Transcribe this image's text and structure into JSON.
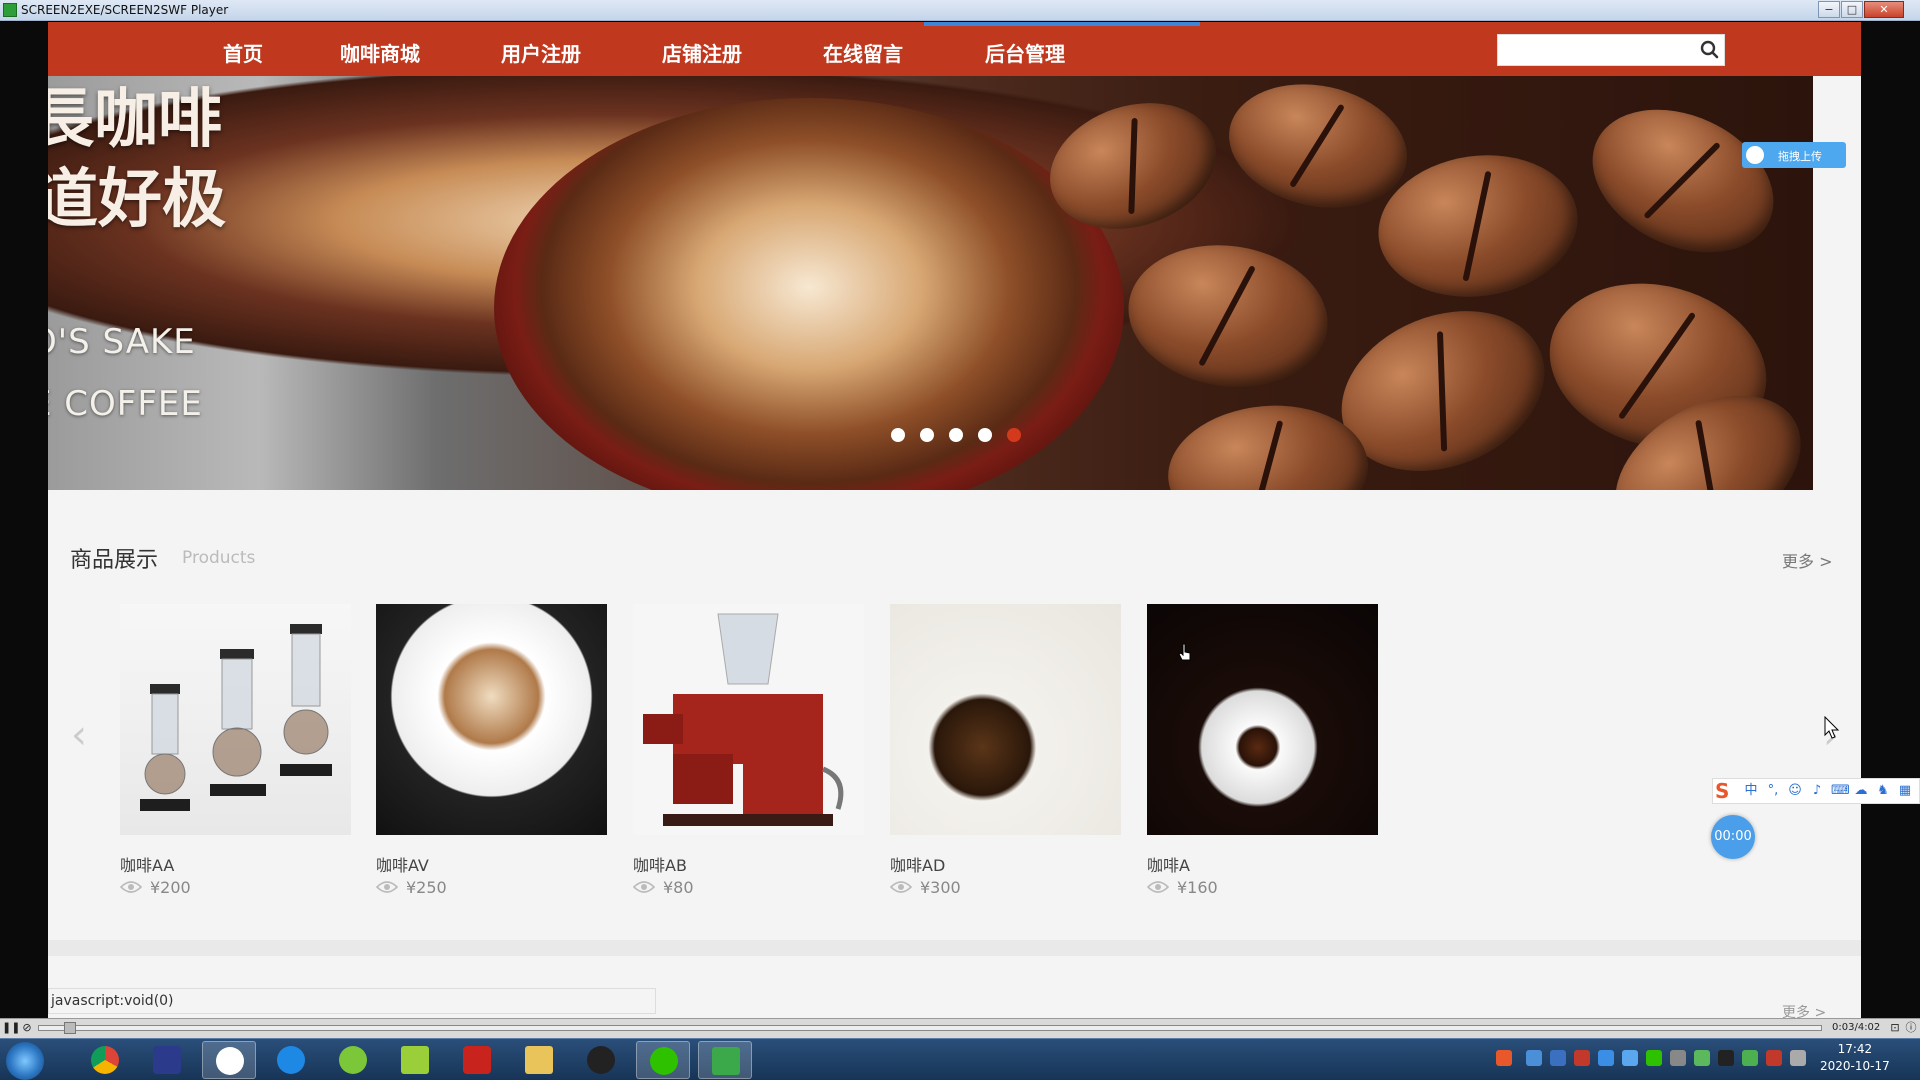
{
  "window": {
    "title": "SCREEN2EXE/SCREEN2SWF Player",
    "buttons": [
      "−",
      "□",
      "✕"
    ]
  },
  "nav": {
    "items": [
      "首页",
      "咖啡商城",
      "用户注册",
      "店铺注册",
      "在线留言",
      "后台管理"
    ],
    "search_placeholder": "",
    "search_icon": "search-icon"
  },
  "banner": {
    "lines": [
      "長咖啡",
      "道好极",
      "O'S SAKE",
      "E COFFEE"
    ],
    "dots": 5,
    "active_dot": 5
  },
  "upload_badge": {
    "label": "拖拽上传",
    "icon": "baidu-cloud-icon"
  },
  "products": {
    "title": "商品展示",
    "subtitle": "Products",
    "more": "更多 >",
    "items": [
      {
        "name": "咖啡AA",
        "price": "¥200"
      },
      {
        "name": "咖啡AV",
        "price": "¥250"
      },
      {
        "name": "咖啡AB",
        "price": "¥80"
      },
      {
        "name": "咖啡AD",
        "price": "¥300"
      },
      {
        "name": "咖啡A",
        "price": "¥160"
      }
    ]
  },
  "status_bar": {
    "url": "javascript:void(0)"
  },
  "section2": {
    "more": "更多 >"
  },
  "timer": "00:00",
  "player": {
    "time": "0:03/4:02"
  },
  "clock": {
    "time": "17:42",
    "date": "2020-10-17"
  },
  "colors": {
    "nav_bg": "#c0381e",
    "active_dot": "#d33a1c",
    "timer_bg": "#4a9eea"
  }
}
